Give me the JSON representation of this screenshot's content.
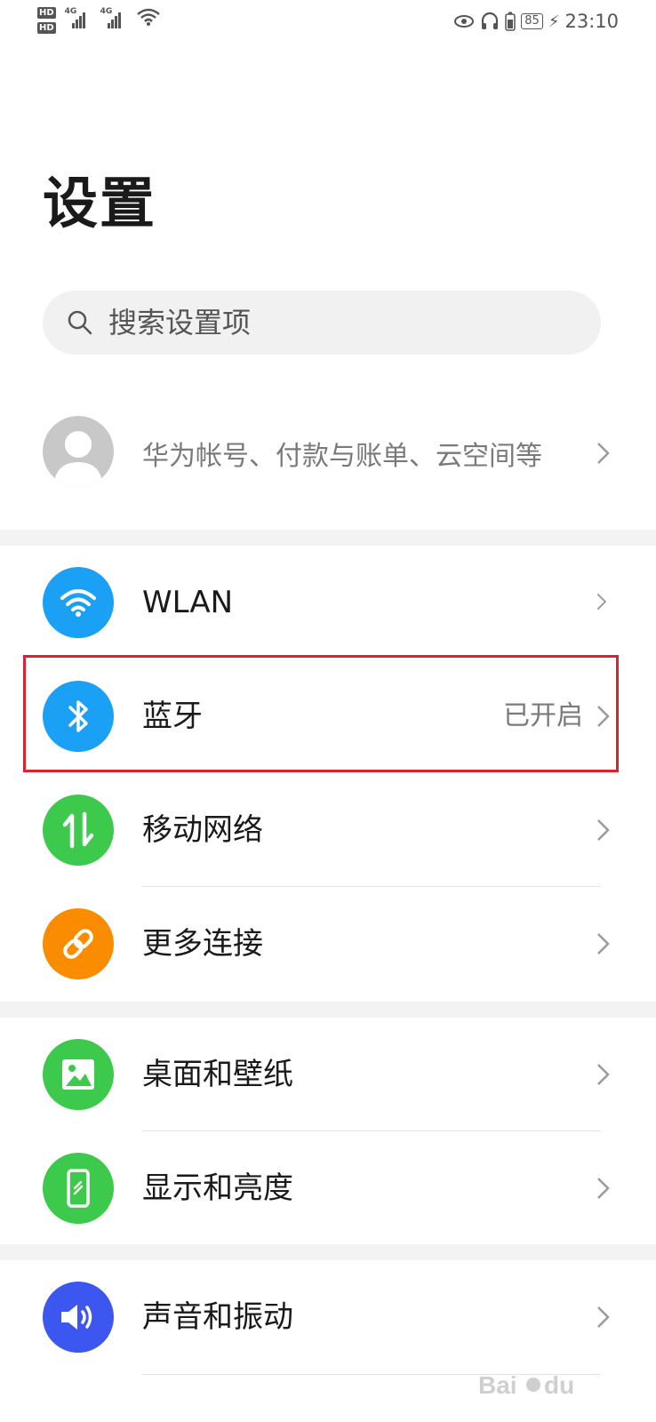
{
  "status_bar": {
    "hd1": "HD",
    "hd2": "HD",
    "net1": "4G",
    "net2": "4G",
    "battery": "85",
    "time": "23:10"
  },
  "page": {
    "title": "设置"
  },
  "search": {
    "placeholder": "搜索设置项"
  },
  "account": {
    "text": "华为帐号、付款与账单、云空间等"
  },
  "items": [
    {
      "label": "WLAN",
      "status": "",
      "icon": "wifi-icon",
      "color": "#1aa1f5"
    },
    {
      "label": "蓝牙",
      "status": "已开启",
      "icon": "bluetooth-icon",
      "color": "#1aa1f5"
    },
    {
      "label": "移动网络",
      "status": "",
      "icon": "mobile-data-icon",
      "color": "#3cc94c"
    },
    {
      "label": "更多连接",
      "status": "",
      "icon": "link-icon",
      "color": "#fb8c00"
    },
    {
      "label": "桌面和壁纸",
      "status": "",
      "icon": "image-icon",
      "color": "#3cc94c"
    },
    {
      "label": "显示和亮度",
      "status": "",
      "icon": "display-icon",
      "color": "#3cc94c"
    },
    {
      "label": "声音和振动",
      "status": "",
      "icon": "speaker-icon",
      "color": "#3b57f0"
    }
  ]
}
